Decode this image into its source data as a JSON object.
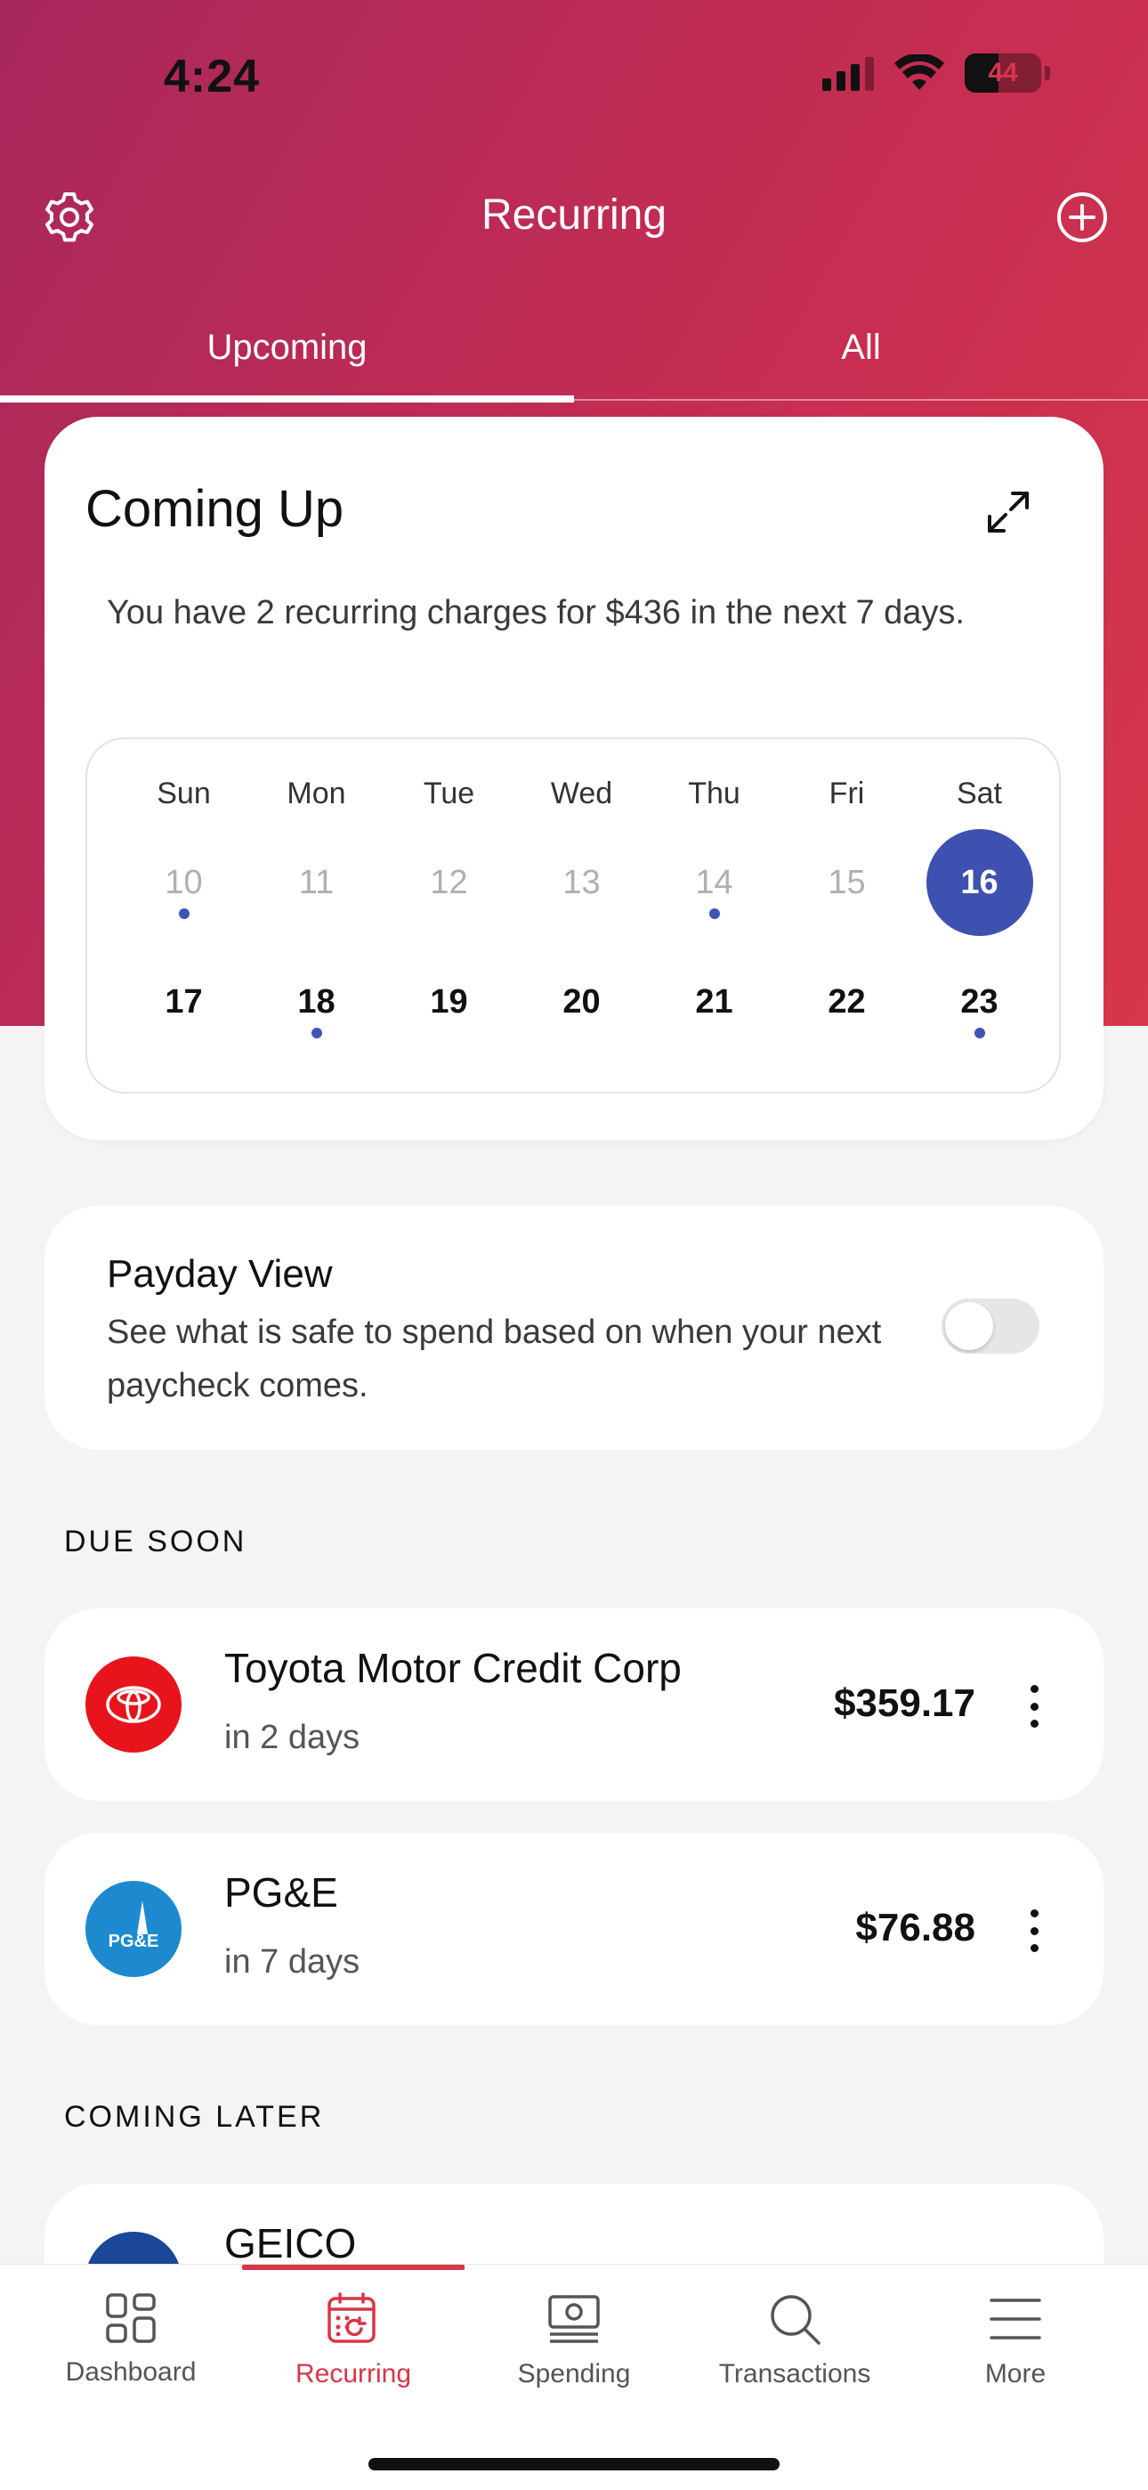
{
  "status_bar": {
    "time": "4:24",
    "battery": "44",
    "battery_level": 0.44
  },
  "header": {
    "title": "Recurring"
  },
  "tabs": [
    {
      "label": "Upcoming",
      "active": true
    },
    {
      "label": "All",
      "active": false
    }
  ],
  "coming_up": {
    "title": "Coming Up",
    "description": "You have 2 recurring charges for $436 in the next 7 days.",
    "weekdays": [
      "Sun",
      "Mon",
      "Tue",
      "Wed",
      "Thu",
      "Fri",
      "Sat"
    ],
    "week1": [
      "10",
      "11",
      "12",
      "13",
      "14",
      "15",
      "16"
    ],
    "week2": [
      "17",
      "18",
      "19",
      "20",
      "21",
      "22",
      "23"
    ],
    "today": "16"
  },
  "payday": {
    "title": "Payday View",
    "description": "See what is safe to spend based on when your next paycheck comes.",
    "enabled": false
  },
  "due_soon": {
    "label": "DUE SOON",
    "items": [
      {
        "name": "Toyota Motor Credit Corp",
        "when": "in 2 days",
        "amount": "$359.17",
        "logo_color": "#e8141c"
      },
      {
        "name": "PG&E",
        "when": "in 7 days",
        "amount": "$76.88",
        "logo_color": "#1d8ad0",
        "logo_text": "PG&E"
      }
    ]
  },
  "coming_later": {
    "label": "COMING LATER",
    "items": [
      {
        "name": "GEICO",
        "logo_color": "#1a4796"
      }
    ]
  },
  "nav": {
    "items": [
      {
        "label": "Dashboard",
        "icon": "dashboard-icon"
      },
      {
        "label": "Recurring",
        "icon": "recurring-calendar-icon",
        "active": true
      },
      {
        "label": "Spending",
        "icon": "spending-icon"
      },
      {
        "label": "Transactions",
        "icon": "search-icon"
      },
      {
        "label": "More",
        "icon": "menu-icon"
      }
    ],
    "accent": "#d8364a"
  }
}
